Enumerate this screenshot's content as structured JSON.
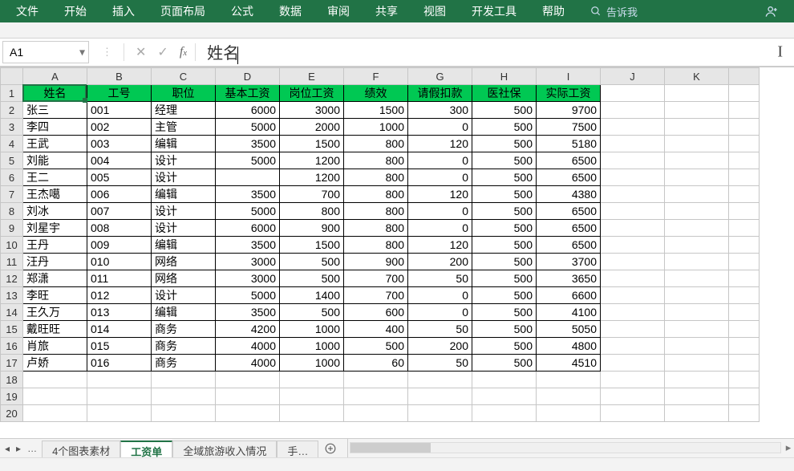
{
  "ribbon": {
    "items": [
      "文件",
      "开始",
      "插入",
      "页面布局",
      "公式",
      "数据",
      "审阅",
      "共享",
      "视图",
      "开发工具",
      "帮助"
    ],
    "search_placeholder": "告诉我"
  },
  "name_box": {
    "value": "A1"
  },
  "formula_bar": {
    "value": "姓名"
  },
  "columns": [
    "A",
    "B",
    "C",
    "D",
    "E",
    "F",
    "G",
    "H",
    "I",
    "J",
    "K",
    ""
  ],
  "row_numbers": [
    1,
    2,
    3,
    4,
    5,
    6,
    7,
    8,
    9,
    10,
    11,
    12,
    13,
    14,
    15,
    16,
    17,
    18,
    19,
    20
  ],
  "headers": [
    "姓名",
    "工号",
    "职位",
    "基本工资",
    "岗位工资",
    "绩效",
    "请假扣款",
    "医社保",
    "实际工资"
  ],
  "rows": [
    {
      "name": "张三",
      "id": "001",
      "title": "经理",
      "base": 6000,
      "post": 3000,
      "perf": 1500,
      "leave": 300,
      "ins": 500,
      "net": 9700
    },
    {
      "name": "李四",
      "id": "002",
      "title": "主管",
      "base": 5000,
      "post": 2000,
      "perf": 1000,
      "leave": 0,
      "ins": 500,
      "net": 7500
    },
    {
      "name": "王武",
      "id": "003",
      "title": "编辑",
      "base": 3500,
      "post": 1500,
      "perf": 800,
      "leave": 120,
      "ins": 500,
      "net": 5180
    },
    {
      "name": "刘能",
      "id": "004",
      "title": "设计",
      "base": 5000,
      "post": 1200,
      "perf": 800,
      "leave": 0,
      "ins": 500,
      "net": 6500
    },
    {
      "name": "王二",
      "id": "005",
      "title": "设计",
      "base": "",
      "post": 1200,
      "perf": 800,
      "leave": 0,
      "ins": 500,
      "net": 6500
    },
    {
      "name": "王杰噶",
      "id": "006",
      "title": "编辑",
      "base": 3500,
      "post": 700,
      "perf": 800,
      "leave": 120,
      "ins": 500,
      "net": 4380
    },
    {
      "name": "刘冰",
      "id": "007",
      "title": "设计",
      "base": 5000,
      "post": 800,
      "perf": 800,
      "leave": 0,
      "ins": 500,
      "net": 6500
    },
    {
      "name": "刘星宇",
      "id": "008",
      "title": "设计",
      "base": 6000,
      "post": 900,
      "perf": 800,
      "leave": 0,
      "ins": 500,
      "net": 6500
    },
    {
      "name": "王丹",
      "id": "009",
      "title": "编辑",
      "base": 3500,
      "post": 1500,
      "perf": 800,
      "leave": 120,
      "ins": 500,
      "net": 6500
    },
    {
      "name": "汪丹",
      "id": "010",
      "title": "网络",
      "base": 3000,
      "post": 500,
      "perf": 900,
      "leave": 200,
      "ins": 500,
      "net": 3700
    },
    {
      "name": "郑潇",
      "id": "011",
      "title": "网络",
      "base": 3000,
      "post": 500,
      "perf": 700,
      "leave": 50,
      "ins": 500,
      "net": 3650
    },
    {
      "name": "李旺",
      "id": "012",
      "title": "设计",
      "base": 5000,
      "post": 1400,
      "perf": 700,
      "leave": 0,
      "ins": 500,
      "net": 6600
    },
    {
      "name": "王久万",
      "id": "013",
      "title": "编辑",
      "base": 3500,
      "post": 500,
      "perf": 600,
      "leave": 0,
      "ins": 500,
      "net": 4100
    },
    {
      "name": "戴旺旺",
      "id": "014",
      "title": "商务",
      "base": 4200,
      "post": 1000,
      "perf": 400,
      "leave": 50,
      "ins": 500,
      "net": 5050
    },
    {
      "name": "肖旅",
      "id": "015",
      "title": "商务",
      "base": 4000,
      "post": 1000,
      "perf": 500,
      "leave": 200,
      "ins": 500,
      "net": 4800
    },
    {
      "name": "卢娇",
      "id": "016",
      "title": "商务",
      "base": 4000,
      "post": 1000,
      "perf": 60,
      "leave": 50,
      "ins": 500,
      "net": 4510
    }
  ],
  "sheet_tabs": {
    "items": [
      "4个图表素材",
      "工资单",
      "全域旅游收入情况",
      "手…"
    ],
    "active_index": 1
  }
}
